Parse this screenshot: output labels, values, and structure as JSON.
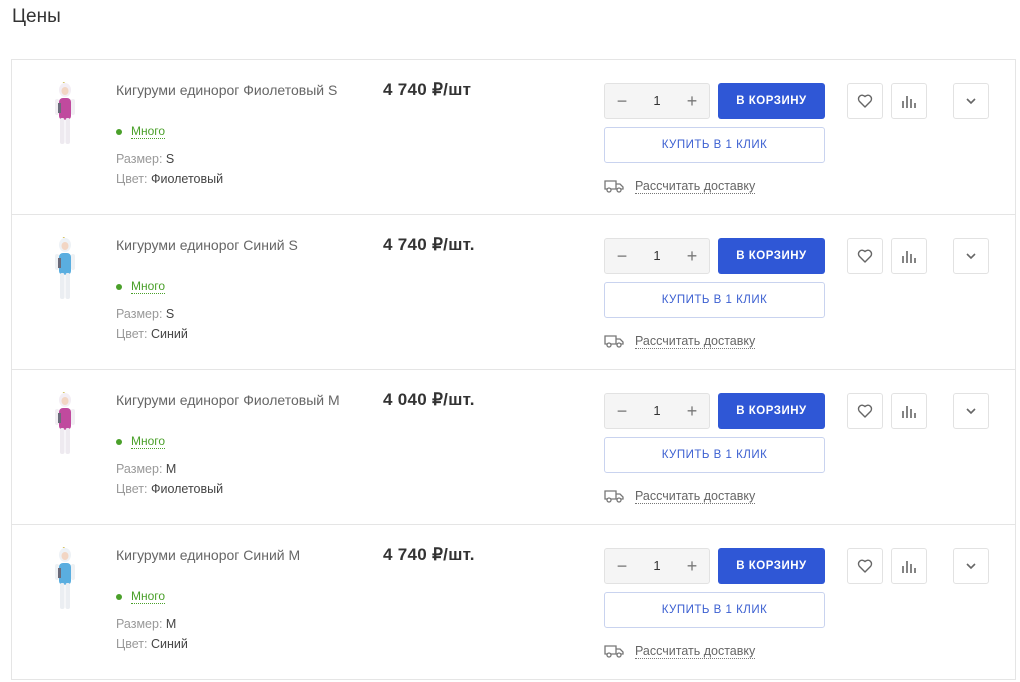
{
  "page": {
    "title": "Цены"
  },
  "labels": {
    "size_label": "Размер: ",
    "color_label": "Цвет: ",
    "cart_button": "В КОРЗИНУ",
    "one_click_button": "КУПИТЬ В 1 КЛИК",
    "delivery_link": "Рассчитать доставку",
    "minus": "−",
    "plus": "+"
  },
  "colors": {
    "accent": "#2f57d6",
    "stock": "#4aa02a",
    "purple_item": "#c04a9e",
    "blue_item": "#5aaee0"
  },
  "products": [
    {
      "name": "Кигуруми единорог Фиолетовый S",
      "stock": "Много",
      "size": "S",
      "color": "Фиолетовый",
      "price": "4 740 ₽/шт",
      "qty": "1",
      "image_icon": "kigurumi-purple-icon"
    },
    {
      "name": "Кигуруми единорог Синий S",
      "stock": "Много",
      "size": "S",
      "color": "Синий",
      "price": "4 740 ₽/шт.",
      "qty": "1",
      "image_icon": "kigurumi-blue-icon"
    },
    {
      "name": "Кигуруми единорог Фиолетовый M",
      "stock": "Много",
      "size": "M",
      "color": "Фиолетовый",
      "price": "4 040 ₽/шт.",
      "qty": "1",
      "image_icon": "kigurumi-purple-icon"
    },
    {
      "name": "Кигуруми единорог Синий M",
      "stock": "Много",
      "size": "M",
      "color": "Синий",
      "price": "4 740 ₽/шт.",
      "qty": "1",
      "image_icon": "kigurumi-blue-icon"
    }
  ]
}
